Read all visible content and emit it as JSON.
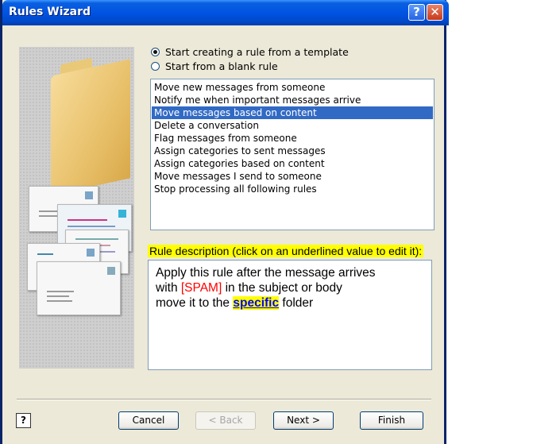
{
  "window": {
    "title": "Rules Wizard",
    "help_button": "?",
    "close_button": "✕"
  },
  "options": {
    "template": "Start creating a rule from a template",
    "blank": "Start from a blank rule",
    "selected": "template"
  },
  "templates": [
    "Move new messages from someone",
    "Notify me when important messages arrive",
    "Move messages based on content",
    "Delete a conversation",
    "Flag messages from someone",
    "Assign categories to sent messages",
    "Assign categories based on content",
    "Move messages I send to someone",
    "Stop processing all following rules"
  ],
  "selected_template": "Move messages based on content",
  "description": {
    "label": "Rule description (click on an underlined value to edit it):",
    "line1": "Apply this rule after the message arrives",
    "line2_prefix": "with ",
    "spam_value": "[SPAM]",
    "line2_suffix": " in the subject or body",
    "line3_prefix": "move it to the ",
    "folder_value": "specific",
    "line3_suffix": " folder"
  },
  "footer": {
    "help_icon": "?",
    "cancel": "Cancel",
    "back": "< Back",
    "next": "Next >",
    "finish": "Finish"
  }
}
